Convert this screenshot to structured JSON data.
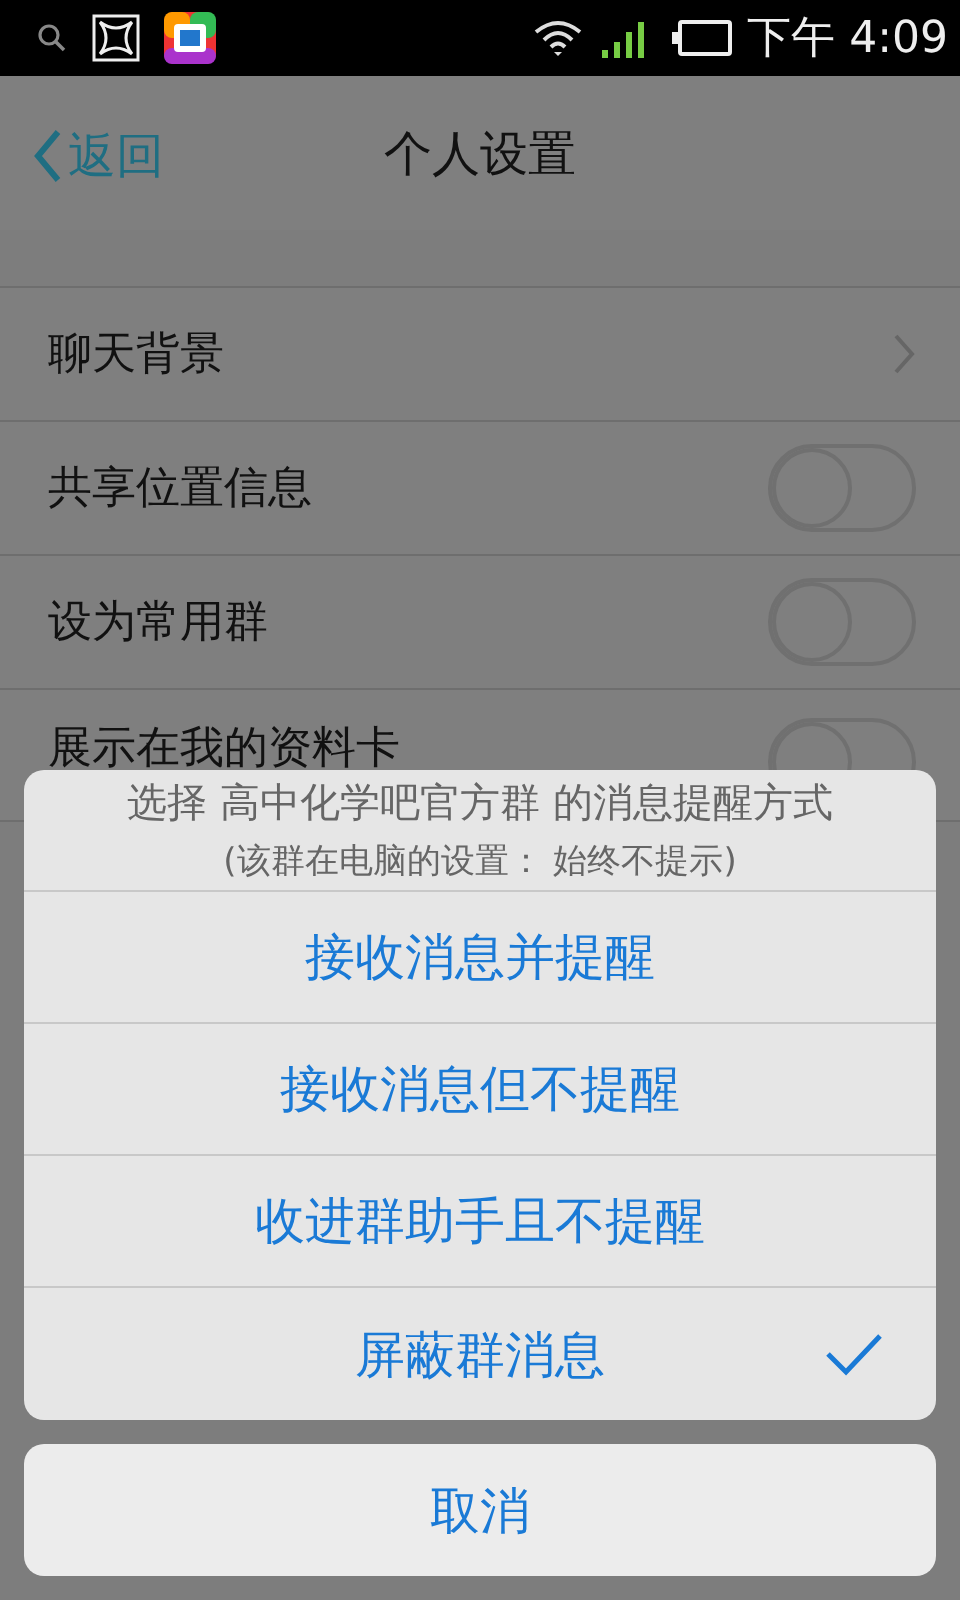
{
  "status_bar": {
    "time": "下午 4:09"
  },
  "nav": {
    "back": "返回",
    "title": "个人设置"
  },
  "settings": {
    "rows": [
      {
        "kind": "link",
        "label": "聊天背景"
      },
      {
        "kind": "toggle",
        "label": "共享位置信息",
        "on": false
      },
      {
        "kind": "toggle",
        "label": "设为常用群",
        "on": false
      },
      {
        "kind": "toggle",
        "label": "展示在我的资料卡",
        "on": false
      }
    ]
  },
  "action_sheet": {
    "title": "选择 高中化学吧官方群 的消息提醒方式",
    "subtitle": "(该群在电脑的设置： 始终不提示)",
    "options": [
      {
        "label": "接收消息并提醒",
        "selected": false
      },
      {
        "label": "接收消息但不提醒",
        "selected": false
      },
      {
        "label": "收进群助手且不提醒",
        "selected": false
      },
      {
        "label": "屏蔽群消息",
        "selected": true
      }
    ],
    "cancel": "取消"
  }
}
